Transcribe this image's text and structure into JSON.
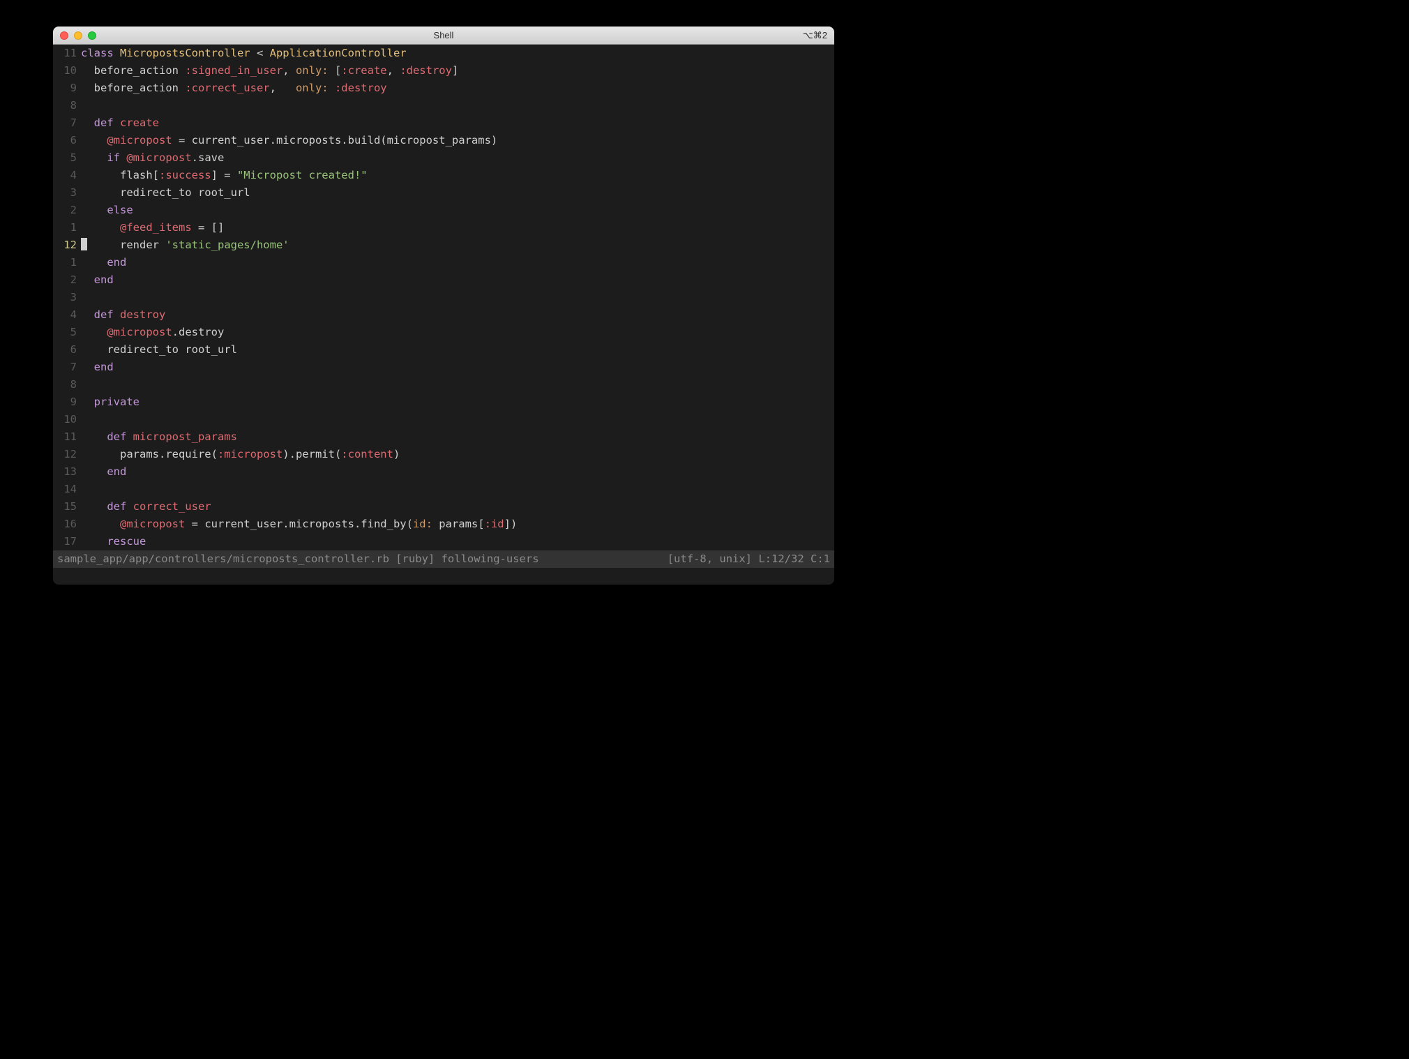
{
  "window": {
    "title": "Shell",
    "shortcut": "⌥⌘2"
  },
  "gutter": [
    "11",
    "10",
    "9",
    "8",
    "7",
    "6",
    "5",
    "4",
    "3",
    "2",
    "1",
    "12",
    "1",
    "2",
    "3",
    "4",
    "5",
    "6",
    "7",
    "8",
    "9",
    "10",
    "11",
    "12",
    "13",
    "14",
    "15",
    "16",
    "17"
  ],
  "current_line_index": 11,
  "lines": [
    [
      [
        "kw",
        "class "
      ],
      [
        "cls",
        "MicropostsController"
      ],
      [
        "pun",
        " < "
      ],
      [
        "cls",
        "ApplicationController"
      ]
    ],
    [
      [
        "id",
        "  before_action "
      ],
      [
        "sym",
        ":signed_in_user"
      ],
      [
        "pun",
        ", "
      ],
      [
        "hash",
        "only: "
      ],
      [
        "pun",
        "["
      ],
      [
        "sym",
        ":create"
      ],
      [
        "pun",
        ", "
      ],
      [
        "sym",
        ":destroy"
      ],
      [
        "pun",
        "]"
      ]
    ],
    [
      [
        "id",
        "  before_action "
      ],
      [
        "sym",
        ":correct_user"
      ],
      [
        "pun",
        ",   "
      ],
      [
        "hash",
        "only: "
      ],
      [
        "sym",
        ":destroy"
      ]
    ],
    [
      [
        "id",
        ""
      ]
    ],
    [
      [
        "kw",
        "  def "
      ],
      [
        "fn",
        "create"
      ]
    ],
    [
      [
        "id",
        "    "
      ],
      [
        "ivar",
        "@micropost"
      ],
      [
        "id",
        " = current_user.microposts.build(micropost_params)"
      ]
    ],
    [
      [
        "id",
        "    "
      ],
      [
        "kw",
        "if "
      ],
      [
        "ivar",
        "@micropost"
      ],
      [
        "id",
        ".save"
      ]
    ],
    [
      [
        "id",
        "      flash["
      ],
      [
        "sym",
        ":success"
      ],
      [
        "id",
        "] = "
      ],
      [
        "str",
        "\"Micropost created!\""
      ]
    ],
    [
      [
        "id",
        "      redirect_to root_url"
      ]
    ],
    [
      [
        "id",
        "    "
      ],
      [
        "kw",
        "else"
      ]
    ],
    [
      [
        "id",
        "      "
      ],
      [
        "ivar",
        "@feed_items"
      ],
      [
        "id",
        " = []"
      ]
    ],
    [
      [
        "id",
        "      render "
      ],
      [
        "str",
        "'static_pages/home'"
      ]
    ],
    [
      [
        "id",
        "    "
      ],
      [
        "kw",
        "end"
      ]
    ],
    [
      [
        "id",
        "  "
      ],
      [
        "kw",
        "end"
      ]
    ],
    [
      [
        "id",
        ""
      ]
    ],
    [
      [
        "kw",
        "  def "
      ],
      [
        "fn",
        "destroy"
      ]
    ],
    [
      [
        "id",
        "    "
      ],
      [
        "ivar",
        "@micropost"
      ],
      [
        "id",
        ".destroy"
      ]
    ],
    [
      [
        "id",
        "    redirect_to root_url"
      ]
    ],
    [
      [
        "id",
        "  "
      ],
      [
        "kw",
        "end"
      ]
    ],
    [
      [
        "id",
        ""
      ]
    ],
    [
      [
        "id",
        "  "
      ],
      [
        "kw",
        "private"
      ]
    ],
    [
      [
        "id",
        ""
      ]
    ],
    [
      [
        "kw",
        "    def "
      ],
      [
        "fn",
        "micropost_params"
      ]
    ],
    [
      [
        "id",
        "      params.require("
      ],
      [
        "sym",
        ":micropost"
      ],
      [
        "id",
        ").permit("
      ],
      [
        "sym",
        ":content"
      ],
      [
        "id",
        ")"
      ]
    ],
    [
      [
        "id",
        "    "
      ],
      [
        "kw",
        "end"
      ]
    ],
    [
      [
        "id",
        ""
      ]
    ],
    [
      [
        "kw",
        "    def "
      ],
      [
        "fn",
        "correct_user"
      ]
    ],
    [
      [
        "id",
        "      "
      ],
      [
        "ivar",
        "@micropost"
      ],
      [
        "id",
        " = current_user.microposts.find_by("
      ],
      [
        "hash",
        "id:"
      ],
      [
        "id",
        " params["
      ],
      [
        "sym",
        ":id"
      ],
      [
        "id",
        "])"
      ]
    ],
    [
      [
        "id",
        "    "
      ],
      [
        "kw",
        "rescue"
      ]
    ]
  ],
  "status": {
    "left": "sample_app/app/controllers/microposts_controller.rb [ruby] following-users",
    "right": "[utf-8, unix] L:12/32 C:1"
  }
}
